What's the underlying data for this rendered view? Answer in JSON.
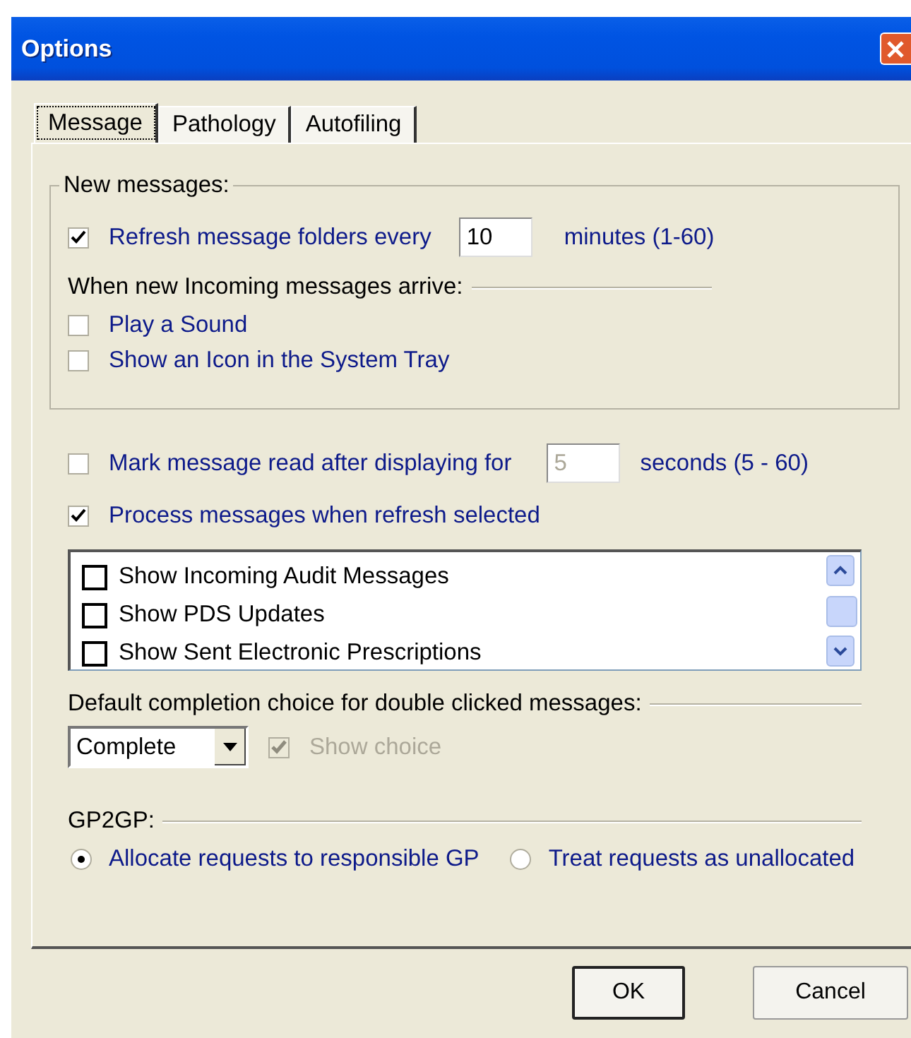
{
  "window": {
    "title": "Options"
  },
  "tabs": [
    {
      "label": "Message",
      "selected": true
    },
    {
      "label": "Pathology",
      "selected": false
    },
    {
      "label": "Autofiling",
      "selected": false
    }
  ],
  "new_messages": {
    "title": "New messages:",
    "refresh": {
      "label": "Refresh message folders every",
      "checked": true,
      "value": "10",
      "suffix": "minutes (1-60)"
    },
    "arrive_heading": "When new Incoming messages arrive:",
    "options": [
      {
        "label": "Play a Sound",
        "checked": false
      },
      {
        "label": "Show an Icon in the System Tray",
        "checked": false
      }
    ]
  },
  "mark_read": {
    "label": "Mark message read after displaying for",
    "checked": false,
    "value": "5",
    "field_disabled": true,
    "suffix": "seconds (5 - 60)"
  },
  "process": {
    "label": "Process messages when refresh selected",
    "checked": true
  },
  "list": {
    "items": [
      {
        "label": "Show Incoming Audit Messages",
        "checked": false
      },
      {
        "label": "Show PDS Updates",
        "checked": false
      },
      {
        "label": "Show Sent Electronic Prescriptions",
        "checked": false
      }
    ]
  },
  "completion": {
    "heading": "Default completion choice for double clicked messages:",
    "dropdown": "Complete",
    "show_choice": {
      "label": "Show choice",
      "checked": true,
      "disabled": true
    }
  },
  "gp2gp": {
    "heading": "GP2GP:",
    "options": [
      {
        "label": "Allocate requests to responsible GP",
        "selected": true
      },
      {
        "label": "Treat requests as unallocated",
        "selected": false
      }
    ]
  },
  "buttons": [
    {
      "label": "OK",
      "default": true
    },
    {
      "label": "Cancel",
      "default": false
    }
  ]
}
